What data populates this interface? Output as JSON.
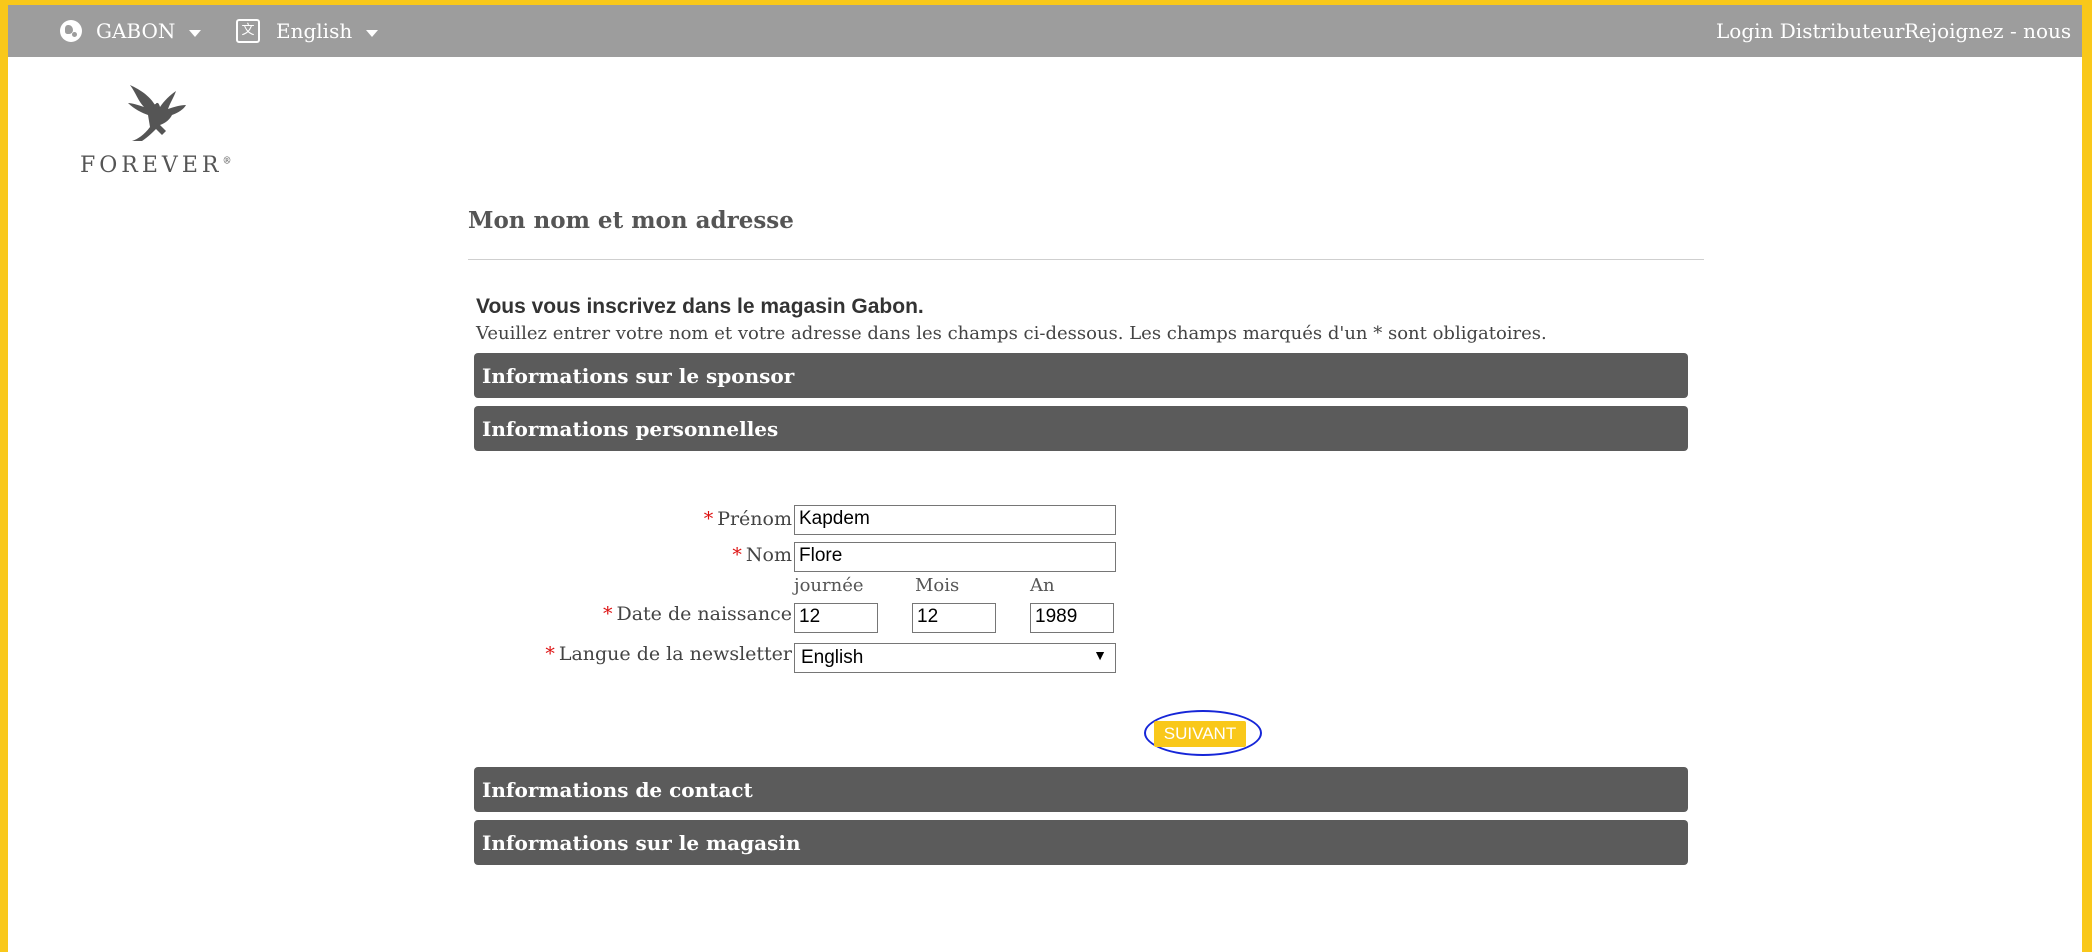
{
  "topbar": {
    "country": "GABON",
    "language": "English",
    "login": "Login Distributeur",
    "join": "Rejoignez - nous",
    "icons": {
      "country": "globe-icon",
      "language": "translate-icon"
    }
  },
  "logo": {
    "brand": "FOREVER",
    "reg": "®"
  },
  "page": {
    "title": "Mon nom et mon adresse",
    "intro_heading": "Vous vous inscrivez dans le magasin Gabon.",
    "intro_text": "Veuillez entrer votre nom et votre adresse dans les champs ci-dessous. Les champs marqués d'un * sont obligatoires."
  },
  "sections": {
    "sponsor": "Informations sur le sponsor",
    "personal": "Informations personnelles",
    "contact": "Informations de contact",
    "store": "Informations sur le magasin"
  },
  "form": {
    "required_mark": "*",
    "first_name": {
      "label": "Prénom",
      "value": "Kapdem"
    },
    "last_name": {
      "label": "Nom",
      "value": "Flore"
    },
    "dob": {
      "label": "Date de naissance",
      "day_label": "journée",
      "month_label": "Mois",
      "year_label": "An",
      "day": "12",
      "month": "12",
      "year": "1989"
    },
    "newsletter": {
      "label": "Langue de la newsletter",
      "value": "English"
    },
    "next_button": "SUIVANT"
  },
  "colors": {
    "accent": "#f9c81a",
    "section_bg": "#5b5b5b",
    "topbar_bg": "#9d9d9d",
    "highlight": "#1626d8"
  }
}
